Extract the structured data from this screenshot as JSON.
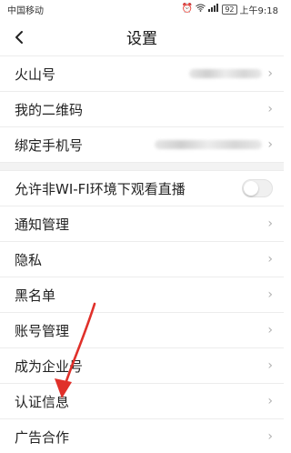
{
  "status_bar": {
    "carrier": "中国移动",
    "battery": "92",
    "time": "上午9:18"
  },
  "nav": {
    "title": "设置"
  },
  "rows_group1": [
    {
      "label": "火山号",
      "value_hidden": true
    },
    {
      "label": "我的二维码"
    },
    {
      "label": "绑定手机号",
      "value_hidden": true
    }
  ],
  "rows_group2": [
    {
      "label": "允许非WI-FI环境下观看直播",
      "toggle": false
    },
    {
      "label": "通知管理"
    },
    {
      "label": "隐私"
    },
    {
      "label": "黑名单"
    },
    {
      "label": "账号管理"
    },
    {
      "label": "成为企业号"
    },
    {
      "label": "认证信息"
    },
    {
      "label": "广告合作"
    }
  ],
  "annotation": {
    "arrow_color": "#e0302a"
  }
}
